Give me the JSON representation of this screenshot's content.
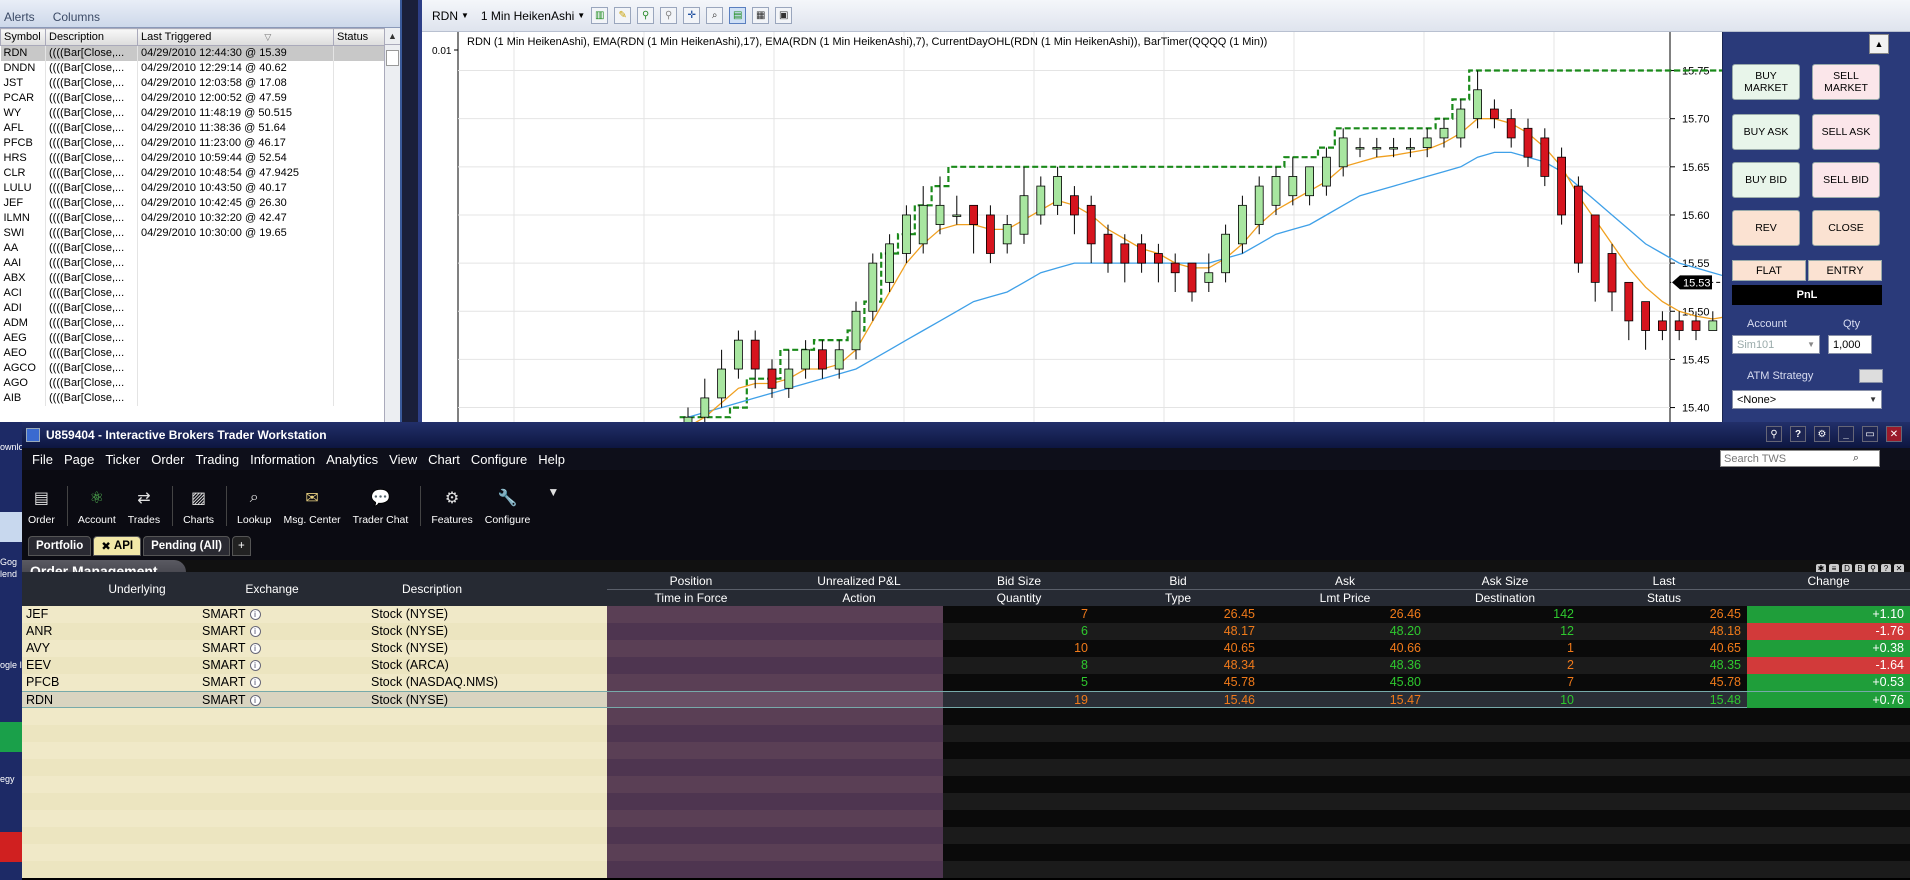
{
  "alerts": {
    "menu": [
      "Alerts",
      "Columns"
    ],
    "columns": [
      "Symbol",
      "Description",
      "Last Triggered",
      "Status"
    ],
    "rows": [
      {
        "symbol": "RDN",
        "desc": "((((Bar[Close,...",
        "last": "04/29/2010 12:44:30 @ 15.39",
        "status": ""
      },
      {
        "symbol": "DNDN",
        "desc": "((((Bar[Close,...",
        "last": "04/29/2010 12:29:14 @ 40.62",
        "status": ""
      },
      {
        "symbol": "JST",
        "desc": "((((Bar[Close,...",
        "last": "04/29/2010 12:03:58 @ 17.08",
        "status": ""
      },
      {
        "symbol": "PCAR",
        "desc": "((((Bar[Close,...",
        "last": "04/29/2010 12:00:52 @ 47.59",
        "status": ""
      },
      {
        "symbol": "WY",
        "desc": "((((Bar[Close,...",
        "last": "04/29/2010 11:48:19 @ 50.515",
        "status": ""
      },
      {
        "symbol": "AFL",
        "desc": "((((Bar[Close,...",
        "last": "04/29/2010 11:38:36 @ 51.64",
        "status": ""
      },
      {
        "symbol": "PFCB",
        "desc": "((((Bar[Close,...",
        "last": "04/29/2010 11:23:00 @ 46.17",
        "status": ""
      },
      {
        "symbol": "HRS",
        "desc": "((((Bar[Close,...",
        "last": "04/29/2010 10:59:44 @ 52.54",
        "status": ""
      },
      {
        "symbol": "CLR",
        "desc": "((((Bar[Close,...",
        "last": "04/29/2010 10:48:54 @ 47.9425",
        "status": ""
      },
      {
        "symbol": "LULU",
        "desc": "((((Bar[Close,...",
        "last": "04/29/2010 10:43:50 @ 40.17",
        "status": ""
      },
      {
        "symbol": "JEF",
        "desc": "((((Bar[Close,...",
        "last": "04/29/2010 10:42:45 @ 26.30",
        "status": ""
      },
      {
        "symbol": "ILMN",
        "desc": "((((Bar[Close,...",
        "last": "04/29/2010 10:32:20 @ 42.47",
        "status": ""
      },
      {
        "symbol": "SWI",
        "desc": "((((Bar[Close,...",
        "last": "04/29/2010 10:30:00 @ 19.65",
        "status": ""
      },
      {
        "symbol": "AA",
        "desc": "((((Bar[Close,...",
        "last": "",
        "status": ""
      },
      {
        "symbol": "AAI",
        "desc": "((((Bar[Close,...",
        "last": "",
        "status": ""
      },
      {
        "symbol": "ABX",
        "desc": "((((Bar[Close,...",
        "last": "",
        "status": ""
      },
      {
        "symbol": "ACI",
        "desc": "((((Bar[Close,...",
        "last": "",
        "status": ""
      },
      {
        "symbol": "ADI",
        "desc": "((((Bar[Close,...",
        "last": "",
        "status": ""
      },
      {
        "symbol": "ADM",
        "desc": "((((Bar[Close,...",
        "last": "",
        "status": ""
      },
      {
        "symbol": "AEG",
        "desc": "((((Bar[Close,...",
        "last": "",
        "status": ""
      },
      {
        "symbol": "AEO",
        "desc": "((((Bar[Close,...",
        "last": "",
        "status": ""
      },
      {
        "symbol": "AGCO",
        "desc": "((((Bar[Close,...",
        "last": "",
        "status": ""
      },
      {
        "symbol": "AGO",
        "desc": "((((Bar[Close,...",
        "last": "",
        "status": ""
      },
      {
        "symbol": "AIB",
        "desc": "((((Bar[Close,...",
        "last": "",
        "status": ""
      }
    ]
  },
  "chart": {
    "instrument": "RDN",
    "period": "1 Min HeikenAshi",
    "title": "RDN (1 Min HeikenAshi), EMA(RDN (1 Min HeikenAshi),17), EMA(RDN (1 Min HeikenAshi),7), CurrentDayOHL(RDN (1 Min HeikenAshi)), BarTimer(QQQQ (1 Min))",
    "last_marker": "15.53"
  },
  "chart_data": {
    "type": "candlestick",
    "title": "RDN (1 Min HeikenAshi), EMA(RDN (1 Min HeikenAshi),17), EMA(RDN (1 Min HeikenAshi),7), CurrentDayOHL(RDN (1 Min HeikenAshi)), BarTimer(QQQQ (1 Min))",
    "ylim": [
      15.385,
      15.79
    ],
    "yticks": [
      "15.75",
      "15.70",
      "15.65",
      "15.60",
      "15.55",
      "15.50",
      "15.45",
      "15.40"
    ],
    "left_axis_tick": "0.01",
    "grid": true,
    "candles": [
      {
        "o": 15.37,
        "c": 15.39,
        "h": 15.4,
        "l": 15.36
      },
      {
        "o": 15.39,
        "c": 15.41,
        "h": 15.43,
        "l": 15.38
      },
      {
        "o": 15.41,
        "c": 15.44,
        "h": 15.46,
        "l": 15.4
      },
      {
        "o": 15.44,
        "c": 15.47,
        "h": 15.48,
        "l": 15.43
      },
      {
        "o": 15.47,
        "c": 15.44,
        "h": 15.48,
        "l": 15.42
      },
      {
        "o": 15.44,
        "c": 15.42,
        "h": 15.45,
        "l": 15.41
      },
      {
        "o": 15.42,
        "c": 15.44,
        "h": 15.46,
        "l": 15.41
      },
      {
        "o": 15.44,
        "c": 15.46,
        "h": 15.47,
        "l": 15.43
      },
      {
        "o": 15.46,
        "c": 15.44,
        "h": 15.47,
        "l": 15.43
      },
      {
        "o": 15.44,
        "c": 15.46,
        "h": 15.47,
        "l": 15.43
      },
      {
        "o": 15.46,
        "c": 15.5,
        "h": 15.51,
        "l": 15.45
      },
      {
        "o": 15.5,
        "c": 15.55,
        "h": 15.56,
        "l": 15.49
      },
      {
        "o": 15.53,
        "c": 15.57,
        "h": 15.58,
        "l": 15.52
      },
      {
        "o": 15.56,
        "c": 15.6,
        "h": 15.61,
        "l": 15.55
      },
      {
        "o": 15.57,
        "c": 15.61,
        "h": 15.63,
        "l": 15.56
      },
      {
        "o": 15.59,
        "c": 15.61,
        "h": 15.64,
        "l": 15.58
      },
      {
        "o": 15.6,
        "c": 15.6,
        "h": 15.62,
        "l": 15.59
      },
      {
        "o": 15.61,
        "c": 15.59,
        "h": 15.61,
        "l": 15.56
      },
      {
        "o": 15.6,
        "c": 15.56,
        "h": 15.61,
        "l": 15.55
      },
      {
        "o": 15.57,
        "c": 15.59,
        "h": 15.6,
        "l": 15.56
      },
      {
        "o": 15.58,
        "c": 15.62,
        "h": 15.65,
        "l": 15.57
      },
      {
        "o": 15.6,
        "c": 15.63,
        "h": 15.64,
        "l": 15.59
      },
      {
        "o": 15.61,
        "c": 15.64,
        "h": 15.65,
        "l": 15.6
      },
      {
        "o": 15.62,
        "c": 15.6,
        "h": 15.63,
        "l": 15.58
      },
      {
        "o": 15.61,
        "c": 15.57,
        "h": 15.62,
        "l": 15.55
      },
      {
        "o": 15.58,
        "c": 15.55,
        "h": 15.59,
        "l": 15.54
      },
      {
        "o": 15.57,
        "c": 15.55,
        "h": 15.58,
        "l": 15.53
      },
      {
        "o": 15.57,
        "c": 15.55,
        "h": 15.58,
        "l": 15.54
      },
      {
        "o": 15.56,
        "c": 15.55,
        "h": 15.57,
        "l": 15.53
      },
      {
        "o": 15.55,
        "c": 15.54,
        "h": 15.56,
        "l": 15.52
      },
      {
        "o": 15.55,
        "c": 15.52,
        "h": 15.55,
        "l": 15.51
      },
      {
        "o": 15.53,
        "c": 15.54,
        "h": 15.56,
        "l": 15.52
      },
      {
        "o": 15.54,
        "c": 15.58,
        "h": 15.59,
        "l": 15.53
      },
      {
        "o": 15.57,
        "c": 15.61,
        "h": 15.62,
        "l": 15.56
      },
      {
        "o": 15.59,
        "c": 15.63,
        "h": 15.64,
        "l": 15.58
      },
      {
        "o": 15.61,
        "c": 15.64,
        "h": 15.65,
        "l": 15.6
      },
      {
        "o": 15.62,
        "c": 15.64,
        "h": 15.66,
        "l": 15.61
      },
      {
        "o": 15.62,
        "c": 15.65,
        "h": 15.65,
        "l": 15.61
      },
      {
        "o": 15.63,
        "c": 15.66,
        "h": 15.67,
        "l": 15.62
      },
      {
        "o": 15.65,
        "c": 15.68,
        "h": 15.69,
        "l": 15.64
      },
      {
        "o": 15.67,
        "c": 15.67,
        "h": 15.68,
        "l": 15.66
      },
      {
        "o": 15.67,
        "c": 15.67,
        "h": 15.68,
        "l": 15.66
      },
      {
        "o": 15.67,
        "c": 15.67,
        "h": 15.68,
        "l": 15.66
      },
      {
        "o": 15.67,
        "c": 15.67,
        "h": 15.68,
        "l": 15.66
      },
      {
        "o": 15.67,
        "c": 15.68,
        "h": 15.69,
        "l": 15.66
      },
      {
        "o": 15.68,
        "c": 15.69,
        "h": 15.7,
        "l": 15.67
      },
      {
        "o": 15.68,
        "c": 15.71,
        "h": 15.72,
        "l": 15.67
      },
      {
        "o": 15.7,
        "c": 15.73,
        "h": 15.75,
        "l": 15.69
      },
      {
        "o": 15.71,
        "c": 15.7,
        "h": 15.72,
        "l": 15.69
      },
      {
        "o": 15.7,
        "c": 15.68,
        "h": 15.71,
        "l": 15.67
      },
      {
        "o": 15.69,
        "c": 15.66,
        "h": 15.7,
        "l": 15.65
      },
      {
        "o": 15.68,
        "c": 15.64,
        "h": 15.69,
        "l": 15.63
      },
      {
        "o": 15.66,
        "c": 15.6,
        "h": 15.67,
        "l": 15.59
      },
      {
        "o": 15.63,
        "c": 15.55,
        "h": 15.64,
        "l": 15.54
      },
      {
        "o": 15.6,
        "c": 15.53,
        "h": 15.6,
        "l": 15.51
      },
      {
        "o": 15.56,
        "c": 15.52,
        "h": 15.57,
        "l": 15.5
      },
      {
        "o": 15.53,
        "c": 15.49,
        "h": 15.53,
        "l": 15.47
      },
      {
        "o": 15.51,
        "c": 15.48,
        "h": 15.51,
        "l": 15.46
      },
      {
        "o": 15.49,
        "c": 15.48,
        "h": 15.5,
        "l": 15.47
      },
      {
        "o": 15.49,
        "c": 15.48,
        "h": 15.5,
        "l": 15.47
      },
      {
        "o": 15.49,
        "c": 15.48,
        "h": 15.5,
        "l": 15.47
      },
      {
        "o": 15.48,
        "c": 15.49,
        "h": 15.5,
        "l": 15.48
      },
      {
        "o": 15.48,
        "c": 15.5,
        "h": 15.51,
        "l": 15.47
      },
      {
        "o": 15.5,
        "c": 15.57,
        "h": 15.58,
        "l": 15.49
      },
      {
        "o": 15.52,
        "c": 15.53,
        "h": 15.55,
        "l": 15.51
      }
    ],
    "ema17": [
      15.39,
      15.395,
      15.4,
      15.405,
      15.41,
      15.415,
      15.42,
      15.425,
      15.43,
      15.435,
      15.44,
      15.45,
      15.46,
      15.47,
      15.48,
      15.49,
      15.5,
      15.51,
      15.515,
      15.52,
      15.53,
      15.54,
      15.545,
      15.55,
      15.55,
      15.55,
      15.55,
      15.55,
      15.55,
      15.55,
      15.55,
      15.55,
      15.555,
      15.56,
      15.57,
      15.58,
      15.585,
      15.59,
      15.6,
      15.61,
      15.62,
      15.625,
      15.63,
      15.635,
      15.64,
      15.645,
      15.65,
      15.66,
      15.665,
      15.665,
      15.66,
      15.655,
      15.645,
      15.63,
      15.615,
      15.6,
      15.585,
      15.57,
      15.56,
      15.55,
      15.545,
      15.54,
      15.535,
      15.535,
      15.53
    ],
    "ema7": [
      15.38,
      15.39,
      15.405,
      15.42,
      15.425,
      15.425,
      15.43,
      15.44,
      15.44,
      15.445,
      15.46,
      15.49,
      15.52,
      15.55,
      15.57,
      15.585,
      15.59,
      15.59,
      15.585,
      15.585,
      15.595,
      15.605,
      15.615,
      15.61,
      15.6,
      15.585,
      15.575,
      15.565,
      15.56,
      15.55,
      15.545,
      15.545,
      15.555,
      15.57,
      15.59,
      15.605,
      15.615,
      15.625,
      15.635,
      15.65,
      15.655,
      15.66,
      15.662,
      15.665,
      15.668,
      15.675,
      15.685,
      15.7,
      15.7,
      15.695,
      15.685,
      15.67,
      15.65,
      15.62,
      15.595,
      15.57,
      15.545,
      15.525,
      15.51,
      15.5,
      15.495,
      15.492,
      15.495,
      15.515,
      15.52
    ],
    "day_high": [
      15.39,
      15.39,
      15.39,
      15.4,
      15.43,
      15.43,
      15.46,
      15.46,
      15.47,
      15.47,
      15.48,
      15.51,
      15.56,
      15.58,
      15.61,
      15.63,
      15.65,
      15.65,
      15.65,
      15.65,
      15.65,
      15.65,
      15.65,
      15.65,
      15.65,
      15.65,
      15.65,
      15.65,
      15.65,
      15.65,
      15.65,
      15.65,
      15.65,
      15.65,
      15.65,
      15.65,
      15.66,
      15.66,
      15.67,
      15.69,
      15.69,
      15.69,
      15.69,
      15.69,
      15.69,
      15.7,
      15.72,
      15.75,
      15.75,
      15.75,
      15.75,
      15.75,
      15.75,
      15.75,
      15.75,
      15.75,
      15.75,
      15.75,
      15.75,
      15.75,
      15.75,
      15.75,
      15.75,
      15.75,
      15.75
    ]
  },
  "trader": {
    "buy_market": "BUY MARKET",
    "sell_market": "SELL MARKET",
    "buy_ask": "BUY ASK",
    "sell_ask": "SELL ASK",
    "buy_bid": "BUY BID",
    "sell_bid": "SELL BID",
    "rev": "REV",
    "close": "CLOSE",
    "flat": "FLAT",
    "entry": "ENTRY",
    "pnl": "PnL",
    "account_label": "Account",
    "qty_label": "Qty",
    "account_value": "Sim101",
    "qty_value": "1,000",
    "atm_label": "ATM Strategy",
    "atm_value": "<None>"
  },
  "desktop": {
    "labels": [
      "ownlo",
      "Gog",
      "lend",
      "ogle I",
      "egy"
    ]
  },
  "tws": {
    "title": "U859404 - Interactive Brokers Trader Workstation",
    "menu": [
      "File",
      "Page",
      "Ticker",
      "Order",
      "Trading",
      "Information",
      "Analytics",
      "View",
      "Chart",
      "Configure",
      "Help"
    ],
    "search_placeholder": "Search TWS",
    "toolbar": [
      "Order",
      "Account",
      "Trades",
      "Charts",
      "Lookup",
      "Msg. Center",
      "Trader Chat",
      "Features",
      "Configure"
    ],
    "tabs": {
      "portfolio": "Portfolio",
      "api": "API",
      "pending": "Pending (All)",
      "plus": "+"
    },
    "section_title": "Order Management",
    "headers": {
      "underlying": "Underlying",
      "exchange": "Exchange",
      "description": "Description",
      "position": "Position",
      "time_in_force": "Time in Force",
      "unrealized_pnl": "Unrealized P&L",
      "action": "Action",
      "bid_size": "Bid Size",
      "quantity": "Quantity",
      "bid": "Bid",
      "type": "Type",
      "ask": "Ask",
      "lmt_price": "Lmt Price",
      "ask_size": "Ask Size",
      "destination": "Destination",
      "last": "Last",
      "status": "Status",
      "change": "Change"
    },
    "rows": [
      {
        "underlying": "JEF",
        "exchange": "SMART",
        "description": "Stock (NYSE)",
        "bid_size": "7",
        "bid": "26.45",
        "ask": "26.46",
        "ask_size": "142",
        "last": "26.45",
        "change": "+1.10",
        "dir": "up",
        "bs_color": "orange",
        "bid_color": "orange",
        "ask_color": "orange",
        "as_color": "green",
        "last_color": "orange"
      },
      {
        "underlying": "ANR",
        "exchange": "SMART",
        "description": "Stock (NYSE)",
        "bid_size": "6",
        "bid": "48.17",
        "ask": "48.20",
        "ask_size": "12",
        "last": "48.18",
        "change": "-1.76",
        "dir": "dn",
        "bs_color": "green",
        "bid_color": "orange",
        "ask_color": "green",
        "as_color": "green",
        "last_color": "orange"
      },
      {
        "underlying": "AVY",
        "exchange": "SMART",
        "description": "Stock (NYSE)",
        "bid_size": "10",
        "bid": "40.65",
        "ask": "40.66",
        "ask_size": "1",
        "last": "40.65",
        "change": "+0.38",
        "dir": "up",
        "bs_color": "orange",
        "bid_color": "orange",
        "ask_color": "orange",
        "as_color": "orange",
        "last_color": "orange"
      },
      {
        "underlying": "EEV",
        "exchange": "SMART",
        "description": "Stock (ARCA)",
        "bid_size": "8",
        "bid": "48.34",
        "ask": "48.36",
        "ask_size": "2",
        "last": "48.35",
        "change": "-1.64",
        "dir": "dn",
        "bs_color": "green",
        "bid_color": "orange",
        "ask_color": "green",
        "as_color": "orange",
        "last_color": "green"
      },
      {
        "underlying": "PFCB",
        "exchange": "SMART",
        "description": "Stock (NASDAQ.NMS)",
        "bid_size": "5",
        "bid": "45.78",
        "ask": "45.80",
        "ask_size": "7",
        "last": "45.78",
        "change": "+0.53",
        "dir": "up",
        "bs_color": "green",
        "bid_color": "orange",
        "ask_color": "green",
        "as_color": "orange",
        "last_color": "orange"
      },
      {
        "underlying": "RDN",
        "exchange": "SMART",
        "description": "Stock (NYSE)",
        "bid_size": "19",
        "bid": "15.46",
        "ask": "15.47",
        "ask_size": "10",
        "last": "15.48",
        "change": "+0.76",
        "dir": "up",
        "bs_color": "orange",
        "bid_color": "orange",
        "ask_color": "orange",
        "as_color": "green",
        "last_color": "green"
      }
    ]
  },
  "colors": {
    "bull": "#a8e6a0",
    "bear": "#d6141e",
    "ema17": "#3fa0e8",
    "ema7": "#f0a020",
    "dayhigh": "#1a8a1a"
  }
}
